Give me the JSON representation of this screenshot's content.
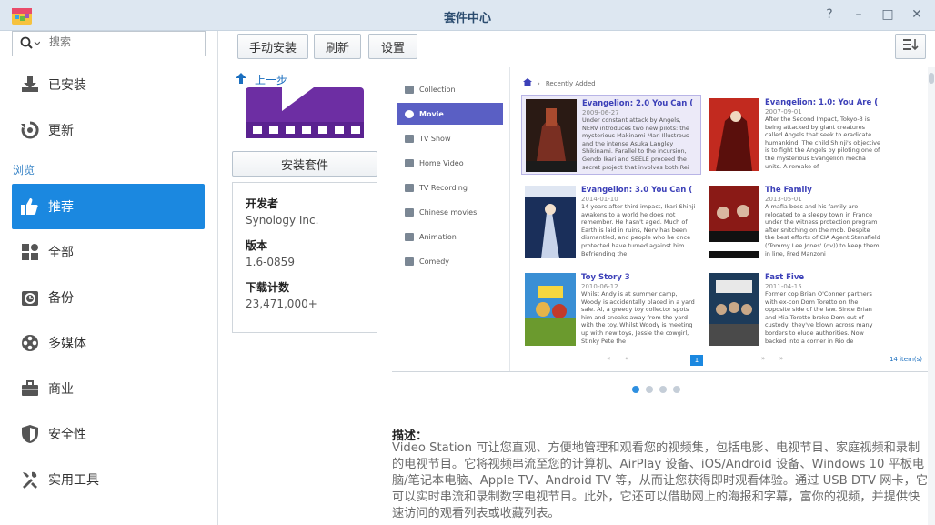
{
  "window": {
    "title": "套件中心",
    "controls": [
      "?",
      "–",
      "□",
      "×"
    ],
    "app_icon": "package-center-icon"
  },
  "sidebar": {
    "search_placeholder": "搜索",
    "items": [
      {
        "label": "已安装",
        "icon": "download-icon"
      },
      {
        "label": "更新",
        "icon": "refresh-icon"
      }
    ],
    "section_label": "浏览",
    "browse": [
      {
        "label": "推荐",
        "icon": "thumbs-up-icon",
        "active": true
      },
      {
        "label": "全部",
        "icon": "grid-icon"
      },
      {
        "label": "备份",
        "icon": "backup-icon"
      },
      {
        "label": "多媒体",
        "icon": "film-reel-icon"
      },
      {
        "label": "商业",
        "icon": "briefcase-icon"
      },
      {
        "label": "安全性",
        "icon": "shield-icon"
      },
      {
        "label": "实用工具",
        "icon": "tools-icon"
      }
    ],
    "active_color": "#1b88e0"
  },
  "toolbar": {
    "manual_install": "手动安装",
    "refresh": "刷新",
    "settings": "设置"
  },
  "package": {
    "back_label": "上一步",
    "install_label": "安装套件",
    "developer_label": "开发者",
    "developer": "Synology Inc.",
    "version_label": "版本",
    "version": "1.6-0859",
    "downloads_label": "下载计数",
    "downloads": "23,471,000+"
  },
  "screenshot": {
    "sidebar": [
      "Collection",
      "Movie",
      "TV Show",
      "Home Video",
      "TV Recording",
      "Chinese movies",
      "Animation",
      "Comedy"
    ],
    "active_index": 1,
    "breadcrumb": "Recently Added",
    "movies": [
      {
        "title": "Evangelion: 2.0 You Can (",
        "date": "2009-06-27",
        "desc": "Under constant attack by Angels, NERV introduces two new pilots: the mysterious Makinami Mari Illustrous and the intense Asuka Langley Shikinami. Parallel to the incursion, Gendo Ikari and SEELE proceed the secret project that involves both Rei",
        "selected": true
      },
      {
        "title": "Evangelion: 1.0: You Are (",
        "date": "2007-09-01",
        "desc": "After the Second Impact, Tokyo-3 is being attacked by giant creatures called Angels that seek to eradicate humankind. The child Shinji's objective is to fight the Angels by piloting one of the mysterious Evangelion mecha units. A remake of"
      },
      {
        "title": "Evangelion: 3.0 You Can (",
        "date": "2014-01-10",
        "desc": "14 years after third impact, Ikari Shinji awakens to a world he does not remember. He hasn't aged. Much of Earth is laid in ruins, Nerv has been dismantled, and people who he once protected have turned against him. Befriending the"
      },
      {
        "title": "The Family",
        "date": "2013-05-01",
        "desc": "A mafia boss and his family are relocated to a sleepy town in France under the witness protection program after snitching on the mob. Despite the best efforts of CIA Agent Stansfield ('Tommy Lee Jones' (qv)) to keep them in line, Fred Manzoni"
      },
      {
        "title": "Toy Story 3",
        "date": "2010-06-12",
        "desc": "Whilst Andy is at summer camp, Woody is accidentally placed in a yard sale. Al, a greedy toy collector spots him and sneaks away from the yard with the toy. Whilst Woody is meeting up with new toys, Jessie the cowgirl, Stinky Pete the"
      },
      {
        "title": "Fast Five",
        "date": "2011-04-15",
        "desc": "Former cop Brian O'Conner partners with ex-con Dom Toretto on the opposite side of the law. Since Brian and Mia Toretto broke Dom out of custody, they've blown across many borders to elude authorities. Now backed into a corner in Rio de"
      }
    ],
    "page": "1",
    "items_count": "14 item(s)"
  },
  "carousel": {
    "count": 4,
    "active": 0
  },
  "description": {
    "heading": "描述：",
    "text": "Video Station 可让您直观、方便地管理和观看您的视频集，包括电影、电视节目、家庭视频和录制的电视节目。它将视频串流至您的计算机、AirPlay 设备、iOS/Android 设备、Windows 10 平板电脑/笔记本电脑、Apple TV、Android TV 等，从而让您获得即时观看体验。通过 USB DTV 网卡，它可以实时串流和录制数字电视节目。此外，它还可以借助网上的海报和字幕，富你的视频，并提供快速访问的观看列表或收藏列表。"
  }
}
